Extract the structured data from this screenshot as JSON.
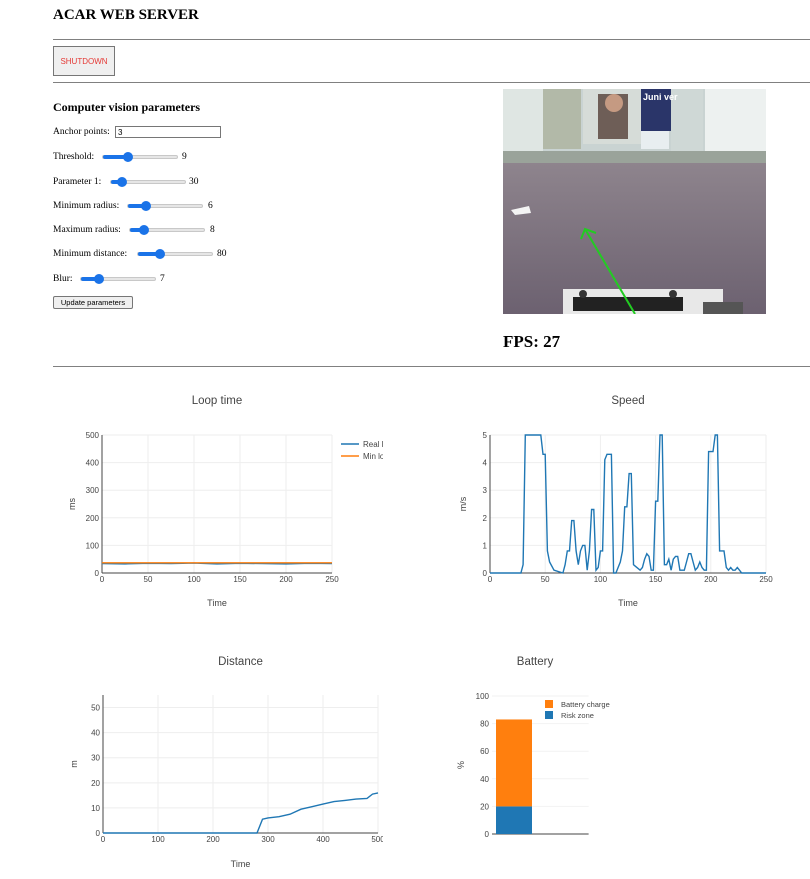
{
  "app": {
    "title": "ACAR WEB SERVER"
  },
  "controls": {
    "shutdown_label": "SHUTDOWN"
  },
  "cv": {
    "title": "Computer vision parameters",
    "anchor": {
      "label": "Anchor points:",
      "value": "3"
    },
    "sliders": [
      {
        "label": "Threshold:",
        "value": "9",
        "level": 0.3
      },
      {
        "label": "Parameter 1:",
        "value": "30",
        "level": 0.09
      },
      {
        "label": "Minimum radius:",
        "value": "6",
        "level": 0.2
      },
      {
        "label": "Maximum radius:",
        "value": "8",
        "level": 0.13
      },
      {
        "label": "Minimum distance:",
        "value": "80",
        "level": 0.25
      },
      {
        "label": "Blur:",
        "value": "7",
        "level": 0.2
      }
    ],
    "update_label": "Update parameters"
  },
  "camera": {
    "sign_text": "Juni ver"
  },
  "fps": {
    "text": "FPS: 27"
  },
  "colors": {
    "blue": "#1f77b4",
    "orange": "#ff7f0e",
    "accent": "#1a73e8",
    "shutdown": "#e53935"
  },
  "chart_data": [
    {
      "type": "line",
      "title": "Loop time",
      "xlabel": "Time",
      "ylabel": "ms",
      "xlim": [
        0,
        250
      ],
      "ylim": [
        0,
        500
      ],
      "xticks": [
        0,
        50,
        100,
        150,
        200,
        250
      ],
      "yticks": [
        0,
        100,
        200,
        300,
        400,
        500
      ],
      "grid": true,
      "legend": "top-right",
      "series": [
        {
          "name": "Real loop time",
          "color": "#1f77b4",
          "x": [
            0,
            25,
            50,
            75,
            100,
            125,
            150,
            175,
            200,
            225,
            250
          ],
          "y": [
            34,
            33,
            35,
            34,
            36,
            33,
            35,
            34,
            33,
            35,
            34
          ]
        },
        {
          "name": "Min loop time",
          "color": "#ff7f0e",
          "x": [
            0,
            250
          ],
          "y": [
            37,
            37
          ]
        }
      ]
    },
    {
      "type": "line",
      "title": "Speed",
      "xlabel": "Time",
      "ylabel": "m/s",
      "xlim": [
        0,
        250
      ],
      "ylim": [
        0,
        5
      ],
      "xticks": [
        0,
        50,
        100,
        150,
        200,
        250
      ],
      "yticks": [
        0,
        1,
        2,
        3,
        4,
        5
      ],
      "grid": true,
      "series": [
        {
          "color": "#1f77b4",
          "x": [
            0,
            28,
            30,
            32,
            34,
            36,
            46,
            48,
            50,
            52,
            54,
            58,
            66,
            68,
            70,
            72,
            74,
            76,
            78,
            80,
            82,
            84,
            86,
            88,
            90,
            92,
            94,
            96,
            98,
            100,
            102,
            104,
            106,
            108,
            110,
            112,
            114,
            116,
            118,
            120,
            122,
            124,
            126,
            128,
            130,
            136,
            138,
            140,
            142,
            144,
            146,
            148,
            150,
            152,
            154,
            156,
            158,
            160,
            162,
            164,
            166,
            168,
            170,
            172,
            174,
            176,
            178,
            180,
            182,
            184,
            186,
            188,
            190,
            192,
            194,
            196,
            198,
            200,
            202,
            204,
            206,
            208,
            210,
            212,
            214,
            216,
            218,
            220,
            222,
            224,
            226,
            228,
            230,
            232,
            234,
            236,
            238,
            240,
            242,
            244,
            246,
            248,
            250
          ],
          "y": [
            0,
            0,
            0.3,
            5,
            5,
            5,
            5,
            4.3,
            4.3,
            0.8,
            0.4,
            0.1,
            0,
            0.3,
            0.8,
            0.8,
            1.9,
            1.9,
            0.8,
            0.3,
            0.8,
            1,
            1,
            0.1,
            0.8,
            2.3,
            2.3,
            0.1,
            0.2,
            0.8,
            0.8,
            4.1,
            4.3,
            4.3,
            4.3,
            0,
            0,
            0.2,
            0.4,
            0.8,
            2.4,
            2.4,
            3.6,
            3.6,
            0.3,
            0.1,
            0.2,
            0.5,
            0.7,
            0.6,
            0.1,
            0.1,
            2.6,
            2.6,
            5,
            5,
            0.3,
            0.3,
            0.5,
            0.1,
            0.5,
            0.6,
            0.6,
            0.1,
            0.1,
            0.1,
            0.4,
            0.7,
            0.7,
            0.4,
            0.1,
            0.2,
            0.4,
            0.2,
            0.1,
            0.1,
            4.4,
            4.4,
            4.4,
            5,
            5,
            0.8,
            0.8,
            0.8,
            0.2,
            0.1,
            0.2,
            0.1,
            0.1,
            0.2,
            0.1,
            0,
            0,
            0,
            0,
            0,
            0,
            0,
            0,
            0,
            0,
            0,
            0
          ]
        }
      ]
    },
    {
      "type": "line",
      "title": "Distance",
      "xlabel": "Time",
      "ylabel": "m",
      "xlim": [
        0,
        500
      ],
      "ylim": [
        0,
        55
      ],
      "xticks": [
        0,
        100,
        200,
        300,
        400,
        500
      ],
      "yticks": [
        0,
        10,
        20,
        30,
        40,
        50
      ],
      "grid": true,
      "series": [
        {
          "color": "#1f77b4",
          "x": [
            0,
            280,
            290,
            300,
            320,
            340,
            360,
            380,
            400,
            420,
            440,
            460,
            480,
            490,
            500
          ],
          "y": [
            0,
            0,
            5.5,
            6,
            6.5,
            7.5,
            9.5,
            10.5,
            11.5,
            12.5,
            13,
            13.5,
            13.8,
            15.5,
            16
          ]
        }
      ]
    },
    {
      "type": "bar",
      "title": "Battery",
      "ylabel": "%",
      "ylim": [
        0,
        100
      ],
      "yticks": [
        0,
        20,
        40,
        60,
        80,
        100
      ],
      "legend": "top-right",
      "stacked": true,
      "series": [
        {
          "name": "Risk zone",
          "color": "#1f77b4",
          "values": [
            20
          ]
        },
        {
          "name": "Battery charge",
          "color": "#ff7f0e",
          "values": [
            63
          ]
        }
      ]
    }
  ]
}
